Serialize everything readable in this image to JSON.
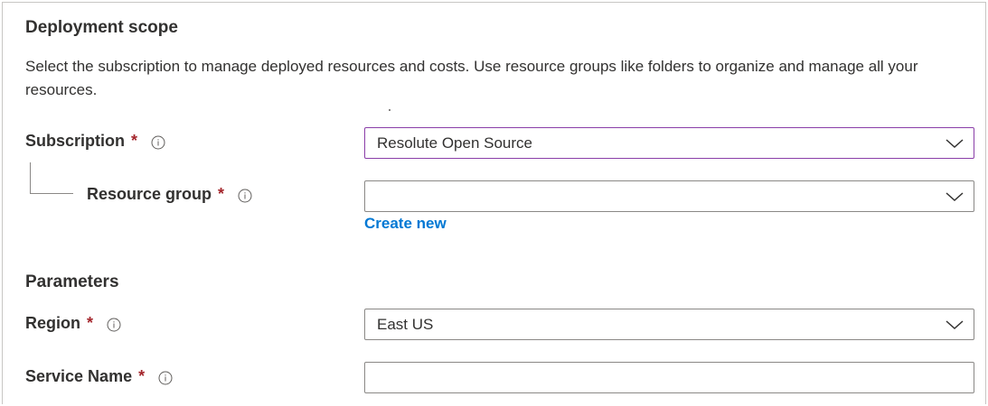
{
  "deployment_scope": {
    "heading": "Deployment scope",
    "description": "Select the subscription to manage deployed resources and costs. Use resource groups like folders to organize and manage all your resources."
  },
  "subscription": {
    "label": "Subscription",
    "required_mark": "*",
    "value": "Resolute Open Source",
    "icon": "info-icon"
  },
  "resource_group": {
    "label": "Resource group",
    "required_mark": "*",
    "value": "",
    "icon": "info-icon",
    "create_new_label": "Create new"
  },
  "parameters": {
    "heading": "Parameters",
    "region": {
      "label": "Region",
      "required_mark": "*",
      "value": "East US",
      "icon": "info-icon"
    },
    "service_name": {
      "label": "Service Name",
      "required_mark": "*",
      "value": "",
      "icon": "info-icon"
    }
  },
  "colors": {
    "required": "#a4262c",
    "link": "#0078d4",
    "focused_border": "#8a3ea8",
    "border": "#8a8886"
  }
}
